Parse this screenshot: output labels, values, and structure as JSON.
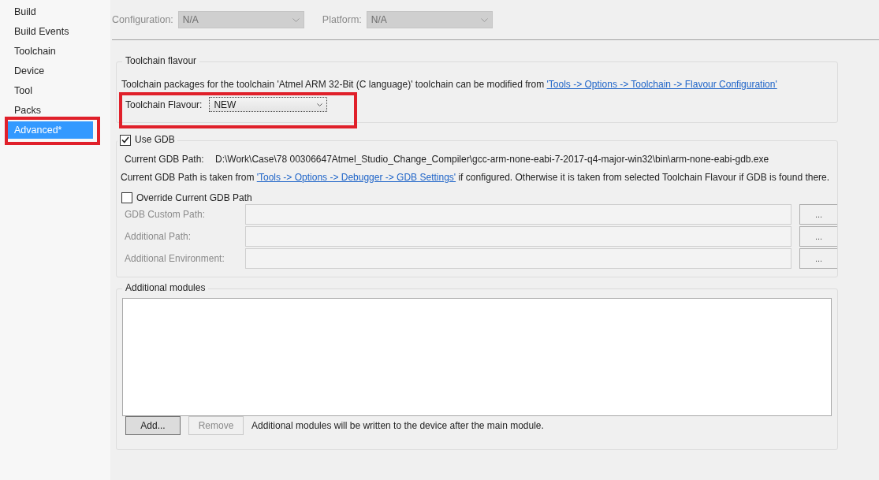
{
  "sidebar": {
    "items": [
      {
        "label": "Build",
        "selected": false,
        "highlighted": false
      },
      {
        "label": "Build Events",
        "selected": false,
        "highlighted": false
      },
      {
        "label": "Toolchain",
        "selected": false,
        "highlighted": false
      },
      {
        "label": "Device",
        "selected": false,
        "highlighted": false
      },
      {
        "label": "Tool",
        "selected": false,
        "highlighted": false
      },
      {
        "label": "Packs",
        "selected": false,
        "highlighted": false
      },
      {
        "label": "Advanced*",
        "selected": true,
        "highlighted": true
      }
    ]
  },
  "top_bar": {
    "configuration": {
      "label": "Configuration:",
      "value": "N/A",
      "disabled": true
    },
    "platform": {
      "label": "Platform:",
      "value": "N/A",
      "disabled": true
    }
  },
  "toolchain_flavour": {
    "title": "Toolchain flavour",
    "description": "Toolchain packages for the toolchain 'Atmel ARM 32-Bit (C language)' toolchain can be modified from",
    "link": "'Tools -> Options -> Toolchain -> Flavour Configuration'",
    "flavour_label": "Toolchain Flavour:",
    "flavour_value": "NEW",
    "highlighted": true
  },
  "gdb": {
    "use_gdb": {
      "label": "Use GDB",
      "checked": true
    },
    "path_label": "Current GDB Path:",
    "path_value": "D:\\Work\\Case\\78 00306647Atmel_Studio_Change_Compiler\\gcc-arm-none-eabi-7-2017-q4-major-win32\\bin\\arm-none-eabi-gdb.exe",
    "note_before": "Current GDB Path is taken from",
    "note_link": "'Tools -> Options -> Debugger -> GDB Settings'",
    "note_after": "if configured. Otherwise it is taken from selected Toolchain Flavour if GDB is found there.",
    "override": {
      "label": "Override Current GDB Path",
      "checked": false
    },
    "fields": [
      {
        "label": "GDB Custom Path:",
        "button": "...",
        "disabled": true
      },
      {
        "label": "Additional Path:",
        "button": "...",
        "disabled": true
      },
      {
        "label": "Additional Environment:",
        "button": "...",
        "disabled": true
      }
    ]
  },
  "additional_modules": {
    "title": "Additional modules",
    "buttons": [
      {
        "label": "Add...",
        "disabled": false
      },
      {
        "label": "Remove",
        "disabled": true
      }
    ],
    "note": "Additional modules will be written to the device after the main module."
  }
}
